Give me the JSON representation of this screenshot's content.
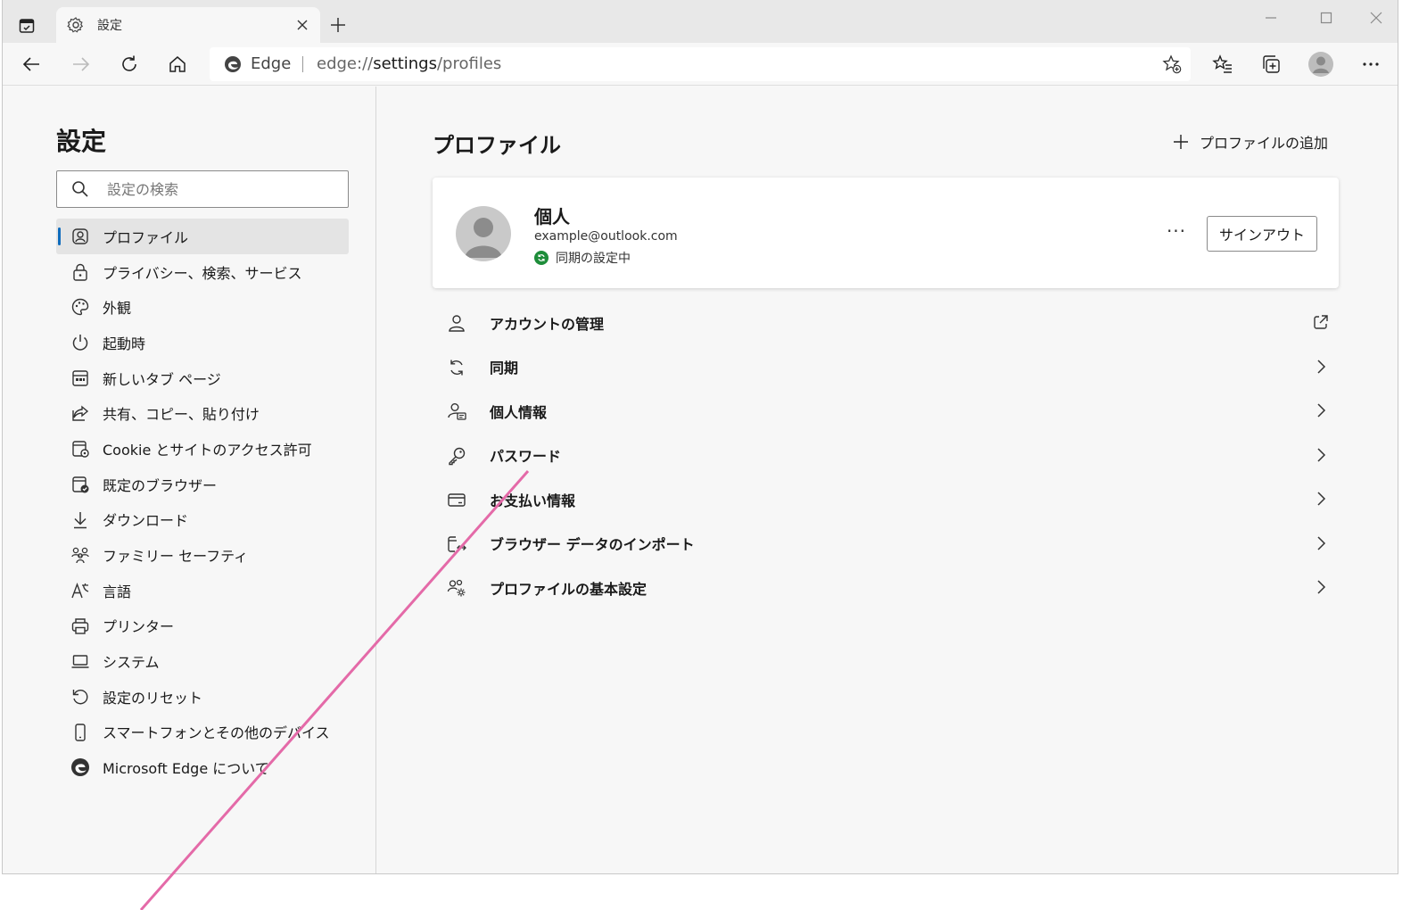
{
  "tab": {
    "title": "設定"
  },
  "address": {
    "site": "Edge",
    "url_prefix": "edge://",
    "url_bold": "settings",
    "url_suffix": "/profiles"
  },
  "sidebar": {
    "title": "設定",
    "search_placeholder": "設定の検索",
    "items": [
      {
        "label": "プロファイル",
        "icon": "profile-icon",
        "active": true
      },
      {
        "label": "プライバシー、検索、サービス",
        "icon": "lock-icon"
      },
      {
        "label": "外観",
        "icon": "palette-icon"
      },
      {
        "label": "起動時",
        "icon": "power-icon"
      },
      {
        "label": "新しいタブ ページ",
        "icon": "newtab-icon"
      },
      {
        "label": "共有、コピー、貼り付け",
        "icon": "share-icon"
      },
      {
        "label": "Cookie とサイトのアクセス許可",
        "icon": "cookie-icon"
      },
      {
        "label": "既定のブラウザー",
        "icon": "default-browser-icon"
      },
      {
        "label": "ダウンロード",
        "icon": "download-icon"
      },
      {
        "label": "ファミリー セーフティ",
        "icon": "family-icon"
      },
      {
        "label": "言語",
        "icon": "language-icon"
      },
      {
        "label": "プリンター",
        "icon": "printer-icon"
      },
      {
        "label": "システム",
        "icon": "laptop-icon"
      },
      {
        "label": "設定のリセット",
        "icon": "reset-icon"
      },
      {
        "label": "スマートフォンとその他のデバイス",
        "icon": "phone-icon"
      },
      {
        "label": "Microsoft Edge について",
        "icon": "edge-icon"
      }
    ]
  },
  "main": {
    "title": "プロファイル",
    "add_profile": "プロファイルの追加",
    "profile": {
      "name": "個人",
      "email": "example@outlook.com",
      "sync_status": "同期の設定中",
      "more": "···",
      "signout": "サインアウト"
    },
    "rows": [
      {
        "label": "アカウントの管理",
        "icon": "person-icon",
        "trailing": "external-link-icon"
      },
      {
        "label": "同期",
        "icon": "sync-icon",
        "trailing": "chevron-right-icon"
      },
      {
        "label": "個人情報",
        "icon": "personal-info-icon",
        "trailing": "chevron-right-icon"
      },
      {
        "label": "パスワード",
        "icon": "key-icon",
        "trailing": "chevron-right-icon"
      },
      {
        "label": "お支払い情報",
        "icon": "card-icon",
        "trailing": "chevron-right-icon"
      },
      {
        "label": "ブラウザー データのインポート",
        "icon": "import-icon",
        "trailing": "chevron-right-icon"
      },
      {
        "label": "プロファイルの基本設定",
        "icon": "profile-settings-icon",
        "trailing": "chevron-right-icon"
      }
    ]
  },
  "colors": {
    "accent": "#0f6cbd",
    "sync_green": "#1e8d3a",
    "annotation_line": "#e46aa8"
  }
}
